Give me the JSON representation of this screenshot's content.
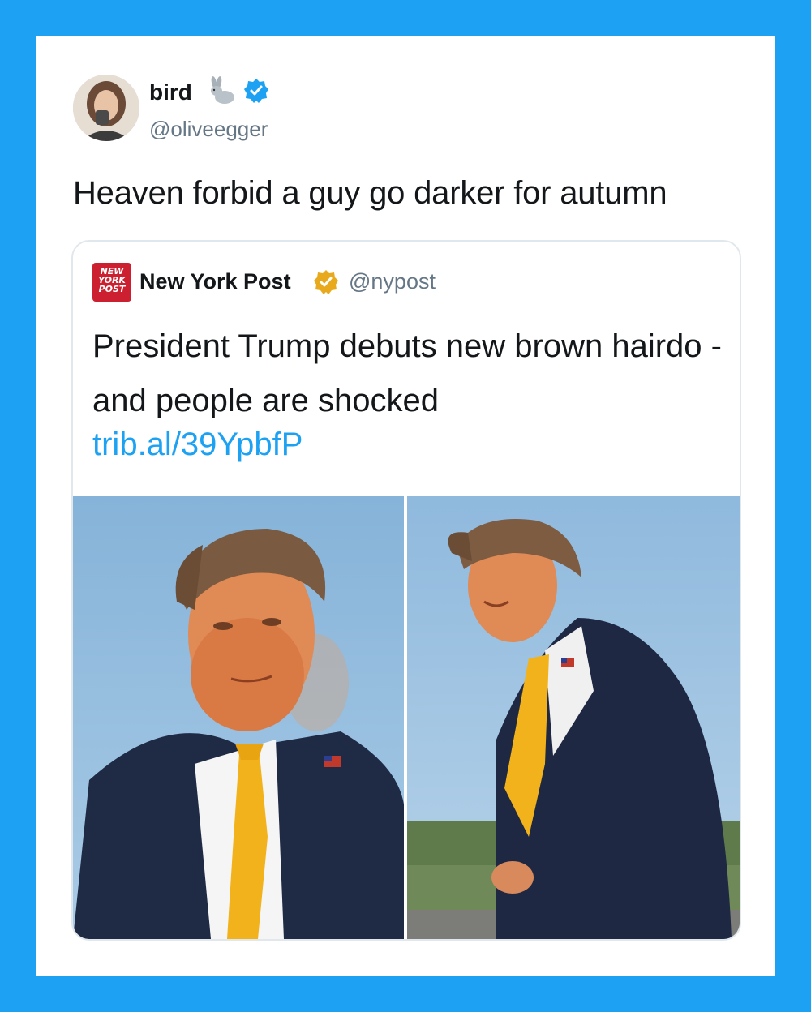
{
  "tweet": {
    "author_name": "bird",
    "author_handle": "@oliveegger",
    "text": "Heaven forbid a guy go darker for autumn"
  },
  "quoted_tweet": {
    "logo_lines": [
      "NEW",
      "YORK",
      "POST"
    ],
    "author_name": "New York Post",
    "author_handle": "@nypost",
    "text": "President Trump debuts new brown hairdo - and people are shocked",
    "link": "trib.al/39YpbfP"
  },
  "icons": {
    "emoji": "rabbit-icon",
    "verified": "verified-icon",
    "gold_verified": "gold-verified-icon"
  },
  "colors": {
    "frame": "#1DA1F2",
    "link": "#1DA1F2",
    "secondary_text": "#657786",
    "nypost_red": "#cc1f2f",
    "gold_badge": "#E8A91C"
  }
}
